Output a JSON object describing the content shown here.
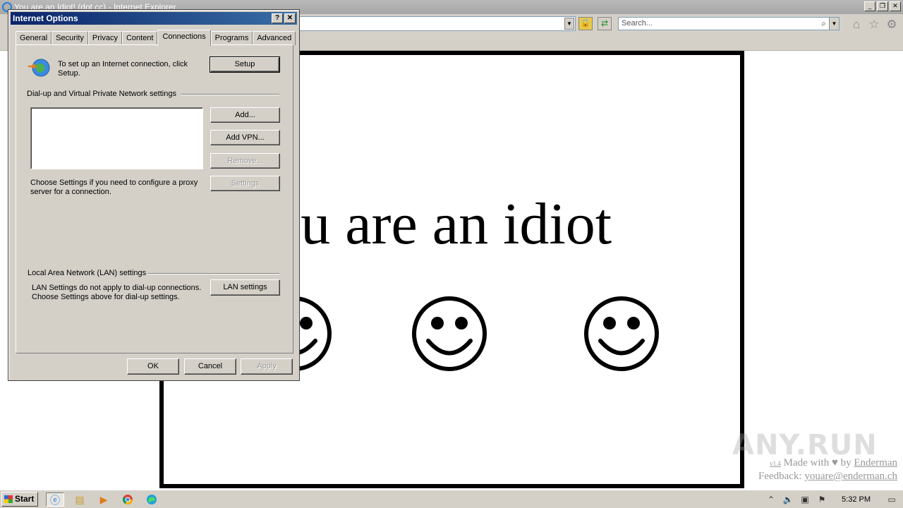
{
  "browser": {
    "title": "You are an Idiot! (dot cc) - Internet Explorer",
    "search_placeholder": "Search..."
  },
  "page": {
    "headline": "You are an idiot",
    "footer": {
      "version": "v1.4",
      "made_with": "Made with",
      "by": "by",
      "author": "Enderman",
      "feedback_label": "Feedback:",
      "feedback_email": "youare@enderman.ch"
    },
    "watermark": "ANY.RUN"
  },
  "dialog": {
    "title": "Internet Options",
    "tabs": [
      "General",
      "Security",
      "Privacy",
      "Content",
      "Connections",
      "Programs",
      "Advanced"
    ],
    "active_tab": "Connections",
    "setup_text": "To set up an Internet connection, click Setup.",
    "setup_button": "Setup",
    "dialup_group": "Dial-up and Virtual Private Network settings",
    "add_button": "Add...",
    "add_vpn_button": "Add VPN...",
    "remove_button": "Remove...",
    "proxy_text": "Choose Settings if you need to configure a proxy server for a connection.",
    "settings_button": "Settings",
    "lan_group": "Local Area Network (LAN) settings",
    "lan_text": "LAN Settings do not apply to dial-up connections. Choose Settings above for dial-up settings.",
    "lan_button": "LAN settings",
    "ok_button": "OK",
    "cancel_button": "Cancel",
    "apply_button": "Apply"
  },
  "taskbar": {
    "start_label": "Start",
    "clock": "5:32 PM"
  }
}
